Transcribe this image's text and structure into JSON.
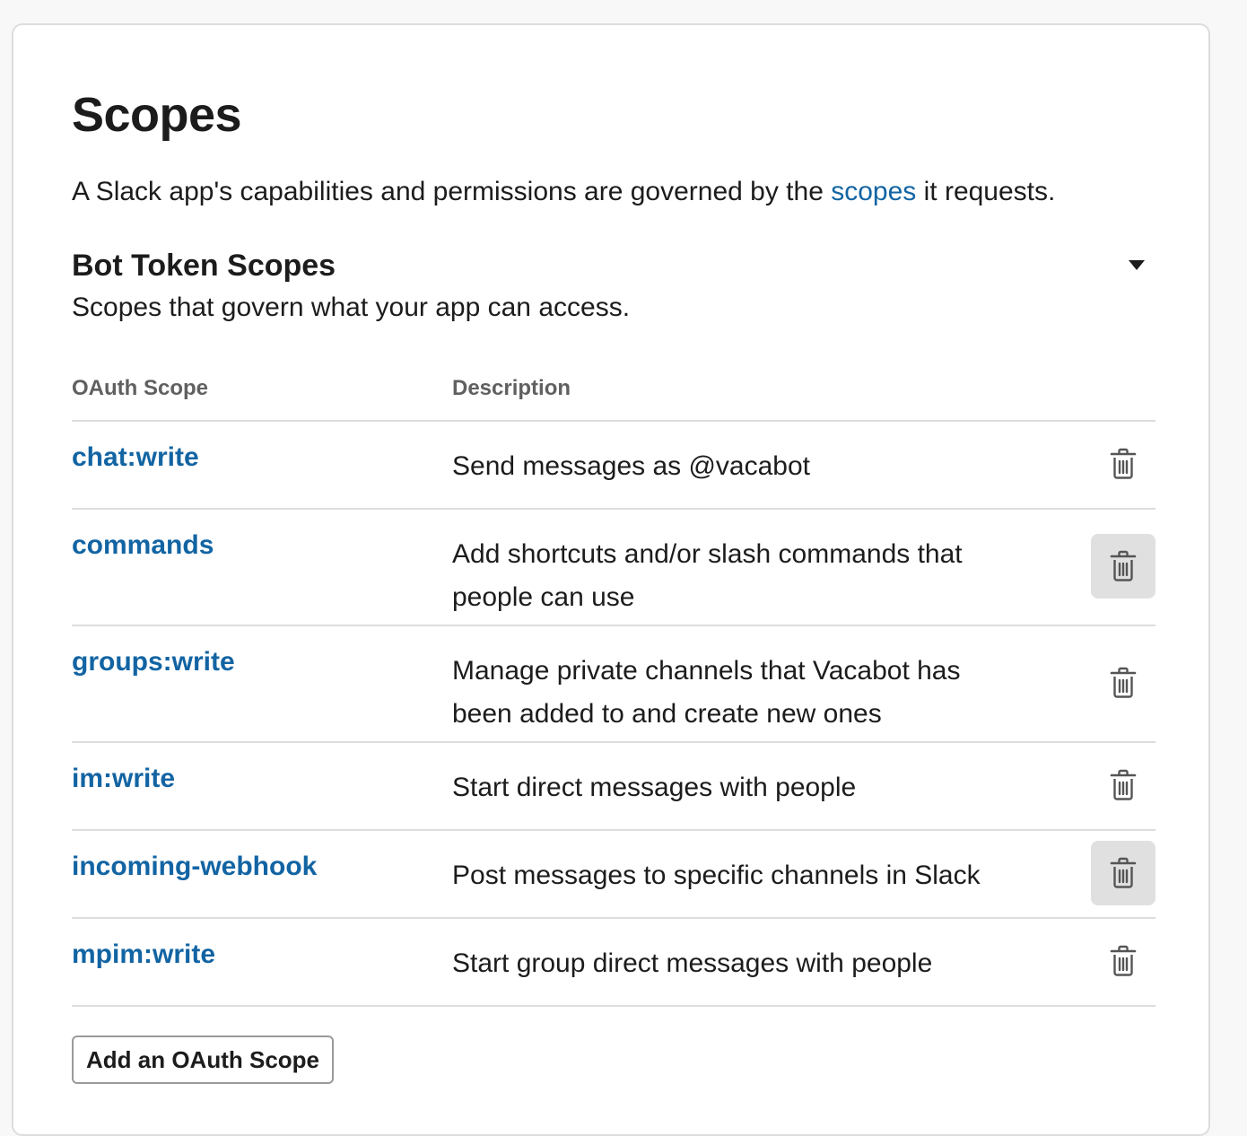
{
  "header": {
    "title": "Scopes",
    "intro_before": "A Slack app's capabilities and permissions are governed by the ",
    "intro_link": "scopes",
    "intro_after": " it requests."
  },
  "bot_section": {
    "title": "Bot Token Scopes",
    "subtitle": "Scopes that govern what your app can access.",
    "collapse_icon": "caret-down-icon"
  },
  "table": {
    "col_scope": "OAuth Scope",
    "col_description": "Description",
    "rows": [
      {
        "scope": "chat:write",
        "description": "Send messages as @vacabot",
        "remove_icon": "trash-icon",
        "hovered": false
      },
      {
        "scope": "commands",
        "description": "Add shortcuts and/or slash commands that people can use",
        "remove_icon": "trash-icon",
        "hovered": true
      },
      {
        "scope": "groups:write",
        "description": "Manage private channels that Vacabot has been added to and create new ones",
        "remove_icon": "trash-icon",
        "hovered": false
      },
      {
        "scope": "im:write",
        "description": "Start direct messages with people",
        "remove_icon": "trash-icon",
        "hovered": false
      },
      {
        "scope": "incoming-webhook",
        "description": "Post messages to specific channels in Slack",
        "remove_icon": "trash-icon",
        "hovered": true
      },
      {
        "scope": "mpim:write",
        "description": "Start group direct messages with people",
        "remove_icon": "trash-icon",
        "hovered": false
      }
    ]
  },
  "actions": {
    "add_scope_label": "Add an OAuth Scope"
  },
  "colors": {
    "link": "#1264a3",
    "text": "#1d1c1d",
    "muted": "#616061",
    "divider": "#dddddd",
    "hover_bg": "#e0e0e0"
  }
}
